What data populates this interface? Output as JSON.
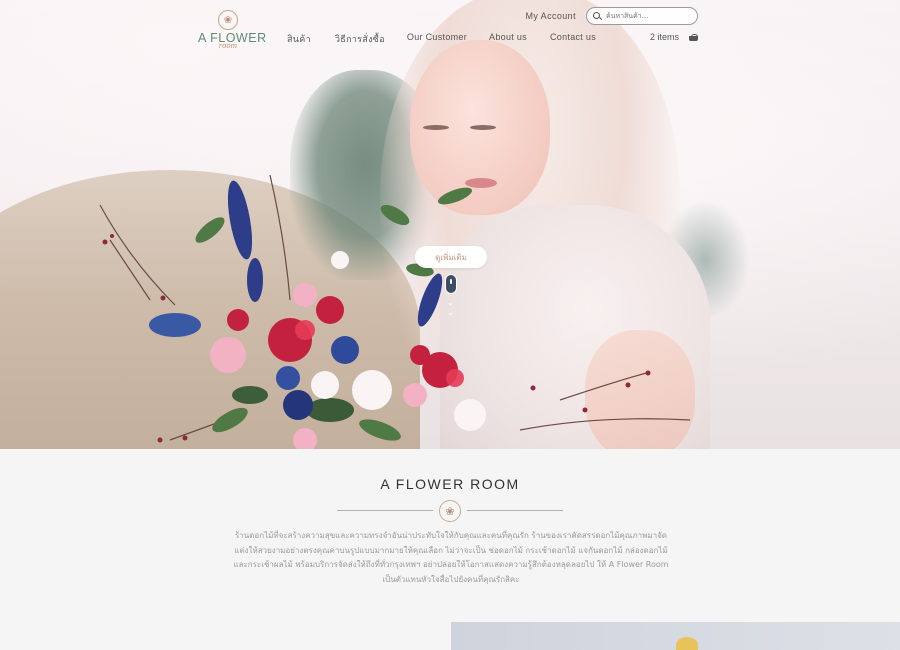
{
  "header": {
    "logo": {
      "name": "A FLOWER",
      "sub": "room"
    },
    "account_label": "My Account",
    "search": {
      "placeholder": "ค้นหาสินค้า..."
    },
    "nav": [
      {
        "label": "สินค้า"
      },
      {
        "label": "วิธีการสั่งซื้อ"
      },
      {
        "label": "Our Customer"
      },
      {
        "label": "About us"
      },
      {
        "label": "Contact us"
      }
    ],
    "cart_label": "2 items"
  },
  "hero": {
    "button_label": "ดูเพิ่มเติม",
    "scroll_icon": "mouse-scroll-icon"
  },
  "about": {
    "title": "A FLOWER ROOM",
    "description": "ร้านดอกไม้ที่จะสร้างความสุขและความทรงจำอันน่าประทับใจให้กับคุณและคนที่คุณรัก ร้านของเราคัดสรรดอกไม้คุณภาพมาจัดแต่งให้สวยงามอย่างตรงคุณค่าบนรูปแบบมากมายให้คุณเลือก ไม่ว่าจะเป็น ช่อดอกไม้ กระเช้าดอกไม้ แจกันดอกไม้ กล่องดอกไม้ และกระเช้าผลไม้ พร้อมบริการจัดส่งให้ถึงที่ทั่วกรุงเทพฯ อย่าปล่อยให้โอกาสแสดงความรู้สึกต้องหลุดลอยไป ให้ A Flower Room เป็นตัวแทนหัวใจสื่อไปยังคนที่คุณรักสิคะ"
  },
  "colors": {
    "accent": "#5d8b78",
    "rose": "#c19880",
    "text": "#555555"
  }
}
